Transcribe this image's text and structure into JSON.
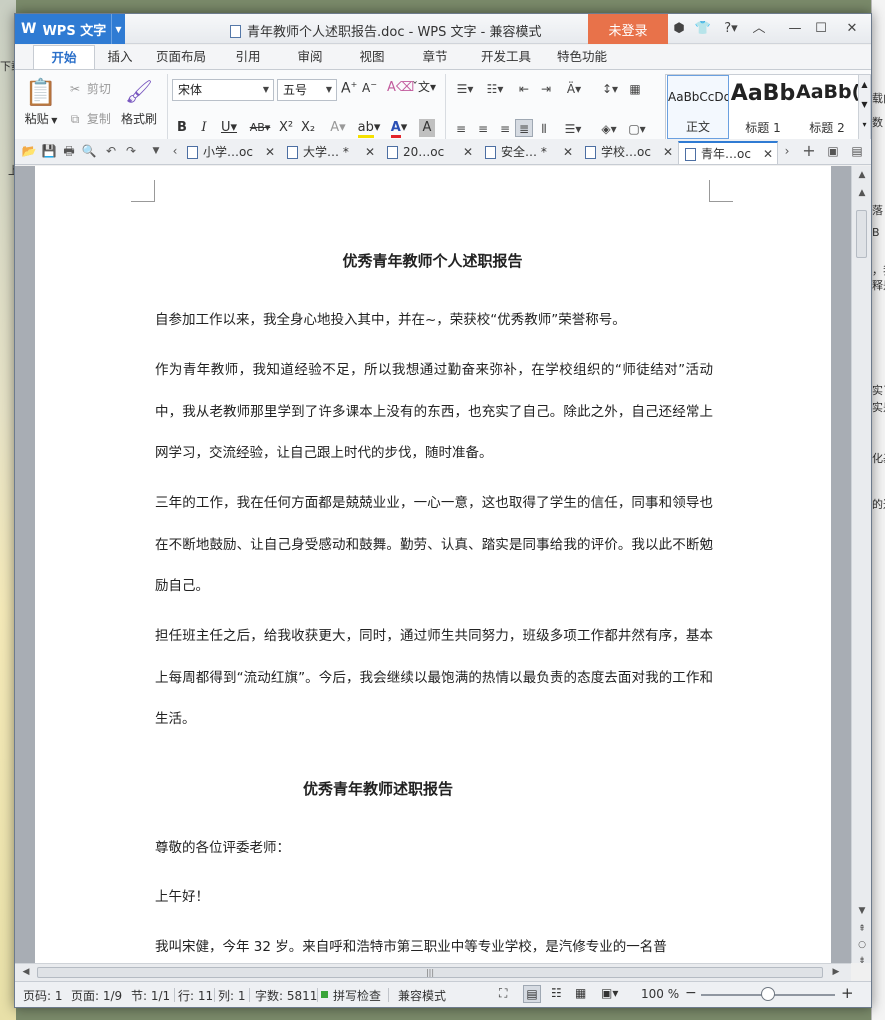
{
  "app": {
    "name": "WPS 文字",
    "window_title": "青年教师个人述职报告.doc - WPS 文字 - 兼容模式",
    "login_label": "未登录"
  },
  "menu_tabs": [
    "开始",
    "插入",
    "页面布局",
    "引用",
    "审阅",
    "视图",
    "章节",
    "开发工具",
    "特色功能"
  ],
  "ribbon": {
    "paste": "粘贴",
    "cut": "剪切",
    "copy": "复制",
    "format_painter": "格式刷",
    "font_name": "宋体",
    "font_size": "五号",
    "styles": [
      {
        "sample": "AaBbCcDd",
        "name": "正文"
      },
      {
        "sample": "AaBb",
        "name": "标题 1"
      },
      {
        "sample": "AaBb(",
        "name": "标题 2"
      }
    ]
  },
  "doc_tabs": [
    {
      "label": "小学…oc",
      "active": false
    },
    {
      "label": "大学… *",
      "active": false
    },
    {
      "label": "20…oc",
      "active": false
    },
    {
      "label": "安全… *",
      "active": false
    },
    {
      "label": "学校…oc",
      "active": false
    },
    {
      "label": "青年…oc",
      "active": true
    }
  ],
  "document": {
    "heading1": "优秀青年教师个人述职报告",
    "p1": "自参加工作以来，我全身心地投入其中，并在~，荣获校“优秀教师”荣誉称号。",
    "p2": "作为青年教师，我知道经验不足，所以我想通过勤奋来弥补，在学校组织的“师徒结对”活动中，我从老教师那里学到了许多课本上没有的东西，也充实了自己。除此之外，自己还经常上网学习，交流经验，让自己跟上时代的步伐，随时准备。",
    "p3": "三年的工作，我在任何方面都是兢兢业业，一心一意，这也取得了学生的信任，同事和领导也在不断地鼓励、让自己身受感动和鼓舞。勤劳、认真、踏实是同事给我的评价。我以此不断勉励自己。",
    "p4": "担任班主任之后，给我收获更大，同时，通过师生共同努力，班级多项工作都井然有序，基本上每周都得到“流动红旗”。今后，我会继续以最饱满的热情以最负责的态度去面对我的工作和生活。",
    "heading2": "优秀青年教师述职报告",
    "p5": "尊敬的各位评委老师：",
    "p6": "上午好！",
    "p7": "我叫宋健，今年 32 岁。来自呼和浩特市第三职业中等专业学校，是汽修专业的一名普"
  },
  "status": {
    "page_num": "页码: 1",
    "pages": "页面: 1/9",
    "section": "节: 1/1",
    "row": "行: 11",
    "col": "列: 1",
    "word_count": "字数: 5811",
    "spell_check": "拼写检查",
    "compat_mode": "兼容模式",
    "zoom": "100 %",
    "zoom_fraction": 0.5
  },
  "background": {
    "left_fragments": [
      "下载",
      "上"
    ],
    "right_fragments": [
      "载内",
      "数",
      "落",
      "B",
      "，我",
      "释是",
      "实了",
      "实是",
      "化基",
      "的达"
    ]
  },
  "colors": {
    "app_blue": "#2f7bd3",
    "login_orange": "#e8724a"
  }
}
